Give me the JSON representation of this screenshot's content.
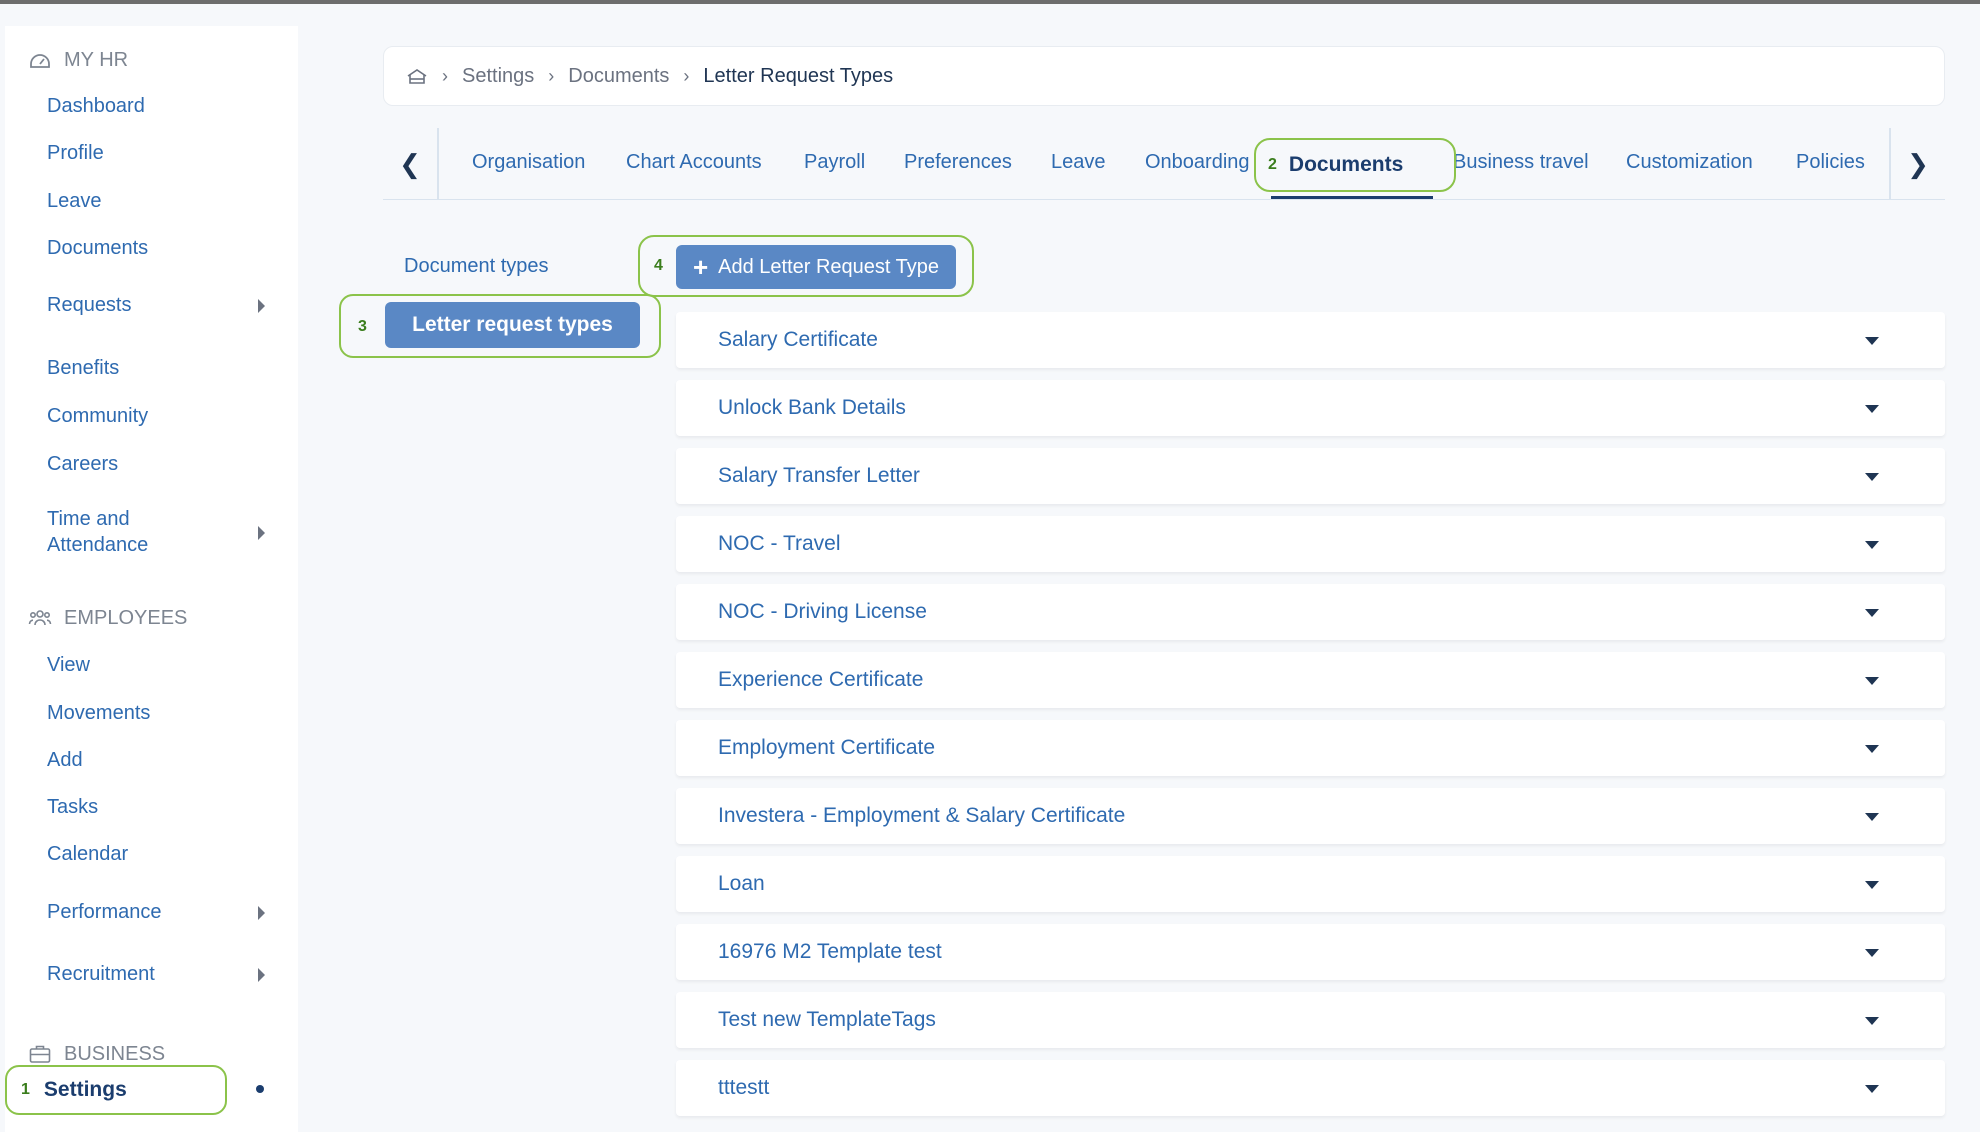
{
  "sidebar": {
    "sections": {
      "my_hr": "MY HR",
      "employees": "EMPLOYEES",
      "business": "BUSINESS"
    },
    "my_hr_items": [
      "Dashboard",
      "Profile",
      "Leave",
      "Documents",
      "Requests",
      "Benefits",
      "Community",
      "Careers"
    ],
    "time_attendance": [
      "Time and",
      "Attendance"
    ],
    "employee_items": [
      "View",
      "Movements",
      "Add",
      "Tasks",
      "Calendar",
      "Performance",
      "Recruitment"
    ],
    "settings": {
      "number": "1",
      "label": "Settings"
    }
  },
  "breadcrumb": {
    "home_icon": "home-icon",
    "items": [
      "Settings",
      "Documents"
    ],
    "current": "Letter Request Types"
  },
  "tabs": {
    "items": [
      "Organisation",
      "Chart Accounts",
      "Payroll",
      "Preferences",
      "Leave",
      "Onboarding",
      "Business travel",
      "Customization",
      "Policies"
    ],
    "active": {
      "number": "2",
      "label": "Documents"
    }
  },
  "subnav": {
    "document_types": "Document types",
    "active": {
      "number": "3",
      "label": "Letter request types"
    }
  },
  "add_button": {
    "number": "4",
    "plus": "+",
    "label": "Add Letter Request Type"
  },
  "letter_types": [
    "Salary Certificate",
    "Unlock Bank Details",
    "Salary Transfer Letter",
    "NOC - Travel",
    "NOC - Driving License",
    "Experience Certificate",
    "Employment Certificate",
    "Investera - Employment & Salary Certificate",
    "Loan",
    "16976 M2 Template test",
    "Test new TemplateTags",
    "tttestt"
  ],
  "colors": {
    "accent": "#5a88c5",
    "link": "#2e6ab0",
    "annotation": "#8bc34a",
    "dark": "#1b3d6e"
  }
}
